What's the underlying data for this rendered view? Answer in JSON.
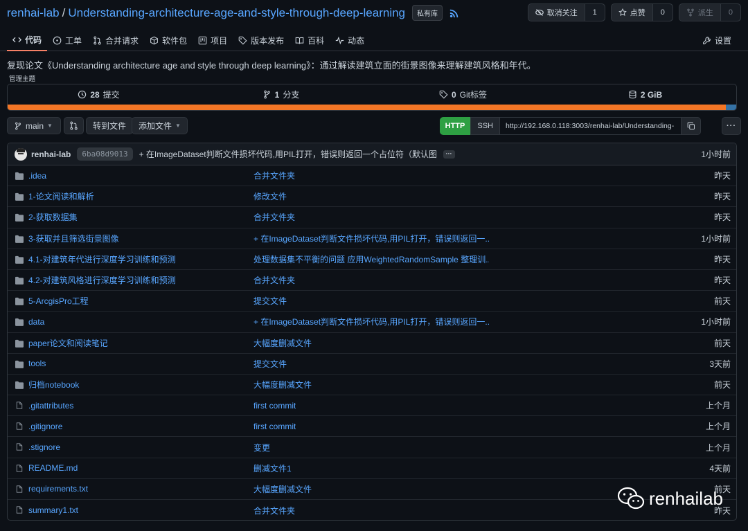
{
  "header": {
    "owner": "renhai-lab",
    "separator": "/",
    "repo": "Understanding-architecture-age-and-style-through-deep-learning",
    "private_badge": "私有库",
    "unwatch_label": "取消关注",
    "watch_count": "1",
    "star_label": "点赞",
    "star_count": "0",
    "fork_label": "派生",
    "fork_count": "0"
  },
  "tabs": [
    {
      "label": "代码",
      "icon": "code-icon"
    },
    {
      "label": "工单",
      "icon": "issue-icon"
    },
    {
      "label": "合并请求",
      "icon": "pull-request-icon"
    },
    {
      "label": "软件包",
      "icon": "package-icon"
    },
    {
      "label": "项目",
      "icon": "project-icon"
    },
    {
      "label": "版本发布",
      "icon": "tag-icon"
    },
    {
      "label": "百科",
      "icon": "book-icon"
    },
    {
      "label": "动态",
      "icon": "pulse-icon"
    }
  ],
  "settings_label": "设置",
  "description": "复现论文《Understanding architecture age and style through deep learning》：通过解读建筑立面的街景图像来理解建筑风格和年代。",
  "manage_topics": "管理主题",
  "stats": {
    "commits_num": "28",
    "commits_label": "提交",
    "branches_num": "1",
    "branches_label": "分支",
    "tags_num": "0",
    "tags_label": "Git标签",
    "size_num": "2 GiB"
  },
  "language_bar": [
    {
      "color": "#f37626",
      "fraction": 0.986
    },
    {
      "color": "#3572a5",
      "fraction": 0.014
    }
  ],
  "toolbar": {
    "branch": "main",
    "goto_file": "转到文件",
    "add_file": "添加文件",
    "http": "HTTP",
    "ssh": "SSH",
    "clone_url": "http://192.168.0.118:3003/renhai-lab/Understanding-"
  },
  "latest_commit": {
    "author": "renhai-lab",
    "sha": "6ba08d9013",
    "message": "+ 在ImageDataset判断文件损坏代码,用PIL打开，错误则返回一个占位符（默认图...",
    "time": "1小时前"
  },
  "files": [
    {
      "type": "dir",
      "name": ".idea",
      "message": "合并文件夹",
      "time": "昨天"
    },
    {
      "type": "dir",
      "name": "1-论文阅读和解析",
      "message": "修改文件",
      "time": "昨天"
    },
    {
      "type": "dir",
      "name": "2-获取数据集",
      "message": "合并文件夹",
      "time": "昨天"
    },
    {
      "type": "dir",
      "name": "3-获取并且筛选街景图像",
      "message": "+ 在ImageDataset判断文件损坏代码,用PIL打开，错误则返回一...",
      "time": "1小时前"
    },
    {
      "type": "dir",
      "name": "4.1-对建筑年代进行深度学习训练和预测",
      "message": "处理数据集不平衡的问题 应用WeightedRandomSample 整理训...",
      "time": "昨天"
    },
    {
      "type": "dir",
      "name": "4.2-对建筑风格进行深度学习训练和预测",
      "message": "合并文件夹",
      "time": "昨天"
    },
    {
      "type": "dir",
      "name": "5-ArcgisPro工程",
      "message": "提交文件",
      "time": "前天"
    },
    {
      "type": "dir",
      "name": "data",
      "message": "+ 在ImageDataset判断文件损坏代码,用PIL打开，错误则返回一...",
      "time": "1小时前"
    },
    {
      "type": "dir",
      "name": "paper论文和阅读笔记",
      "message": "大幅度删减文件",
      "time": "前天"
    },
    {
      "type": "dir",
      "name": "tools",
      "message": "提交文件",
      "time": "3天前"
    },
    {
      "type": "dir",
      "name": "归档notebook",
      "message": "大幅度删减文件",
      "time": "前天"
    },
    {
      "type": "file",
      "name": ".gitattributes",
      "message": "first commit",
      "time": "上个月"
    },
    {
      "type": "file",
      "name": ".gitignore",
      "message": "first commit",
      "time": "上个月"
    },
    {
      "type": "file",
      "name": ".stignore",
      "message": "变更",
      "time": "上个月"
    },
    {
      "type": "file",
      "name": "README.md",
      "message": "删减文件1",
      "time": "4天前"
    },
    {
      "type": "file",
      "name": "requirements.txt",
      "message": "大幅度删减文件",
      "time": "前天"
    },
    {
      "type": "file",
      "name": "summary1.txt",
      "message": "合并文件夹",
      "time": "昨天"
    }
  ],
  "watermark": "renhailab",
  "colors": {
    "link": "#58a6ff",
    "background": "#0d1117",
    "accent_tab": "#f78166",
    "http_button": "#2ea043"
  }
}
